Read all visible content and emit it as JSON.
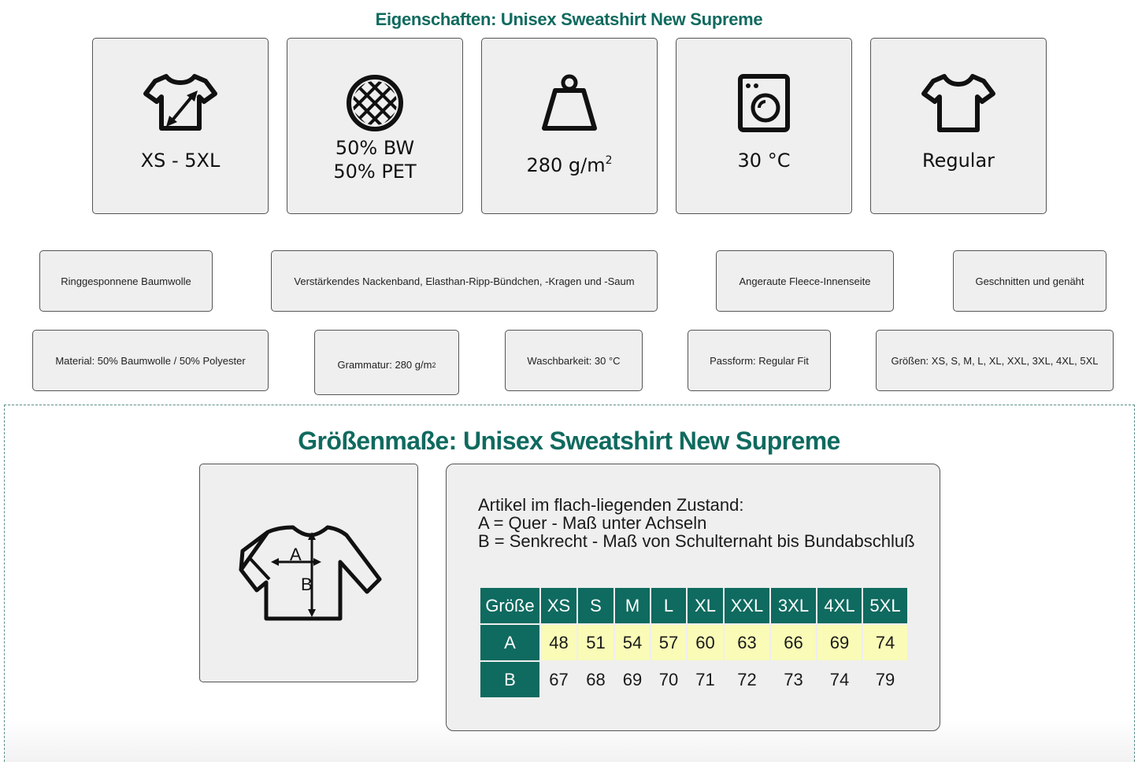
{
  "properties_title": "Eigenschaften: Unisex Sweatshirt New Supreme",
  "property_cards": [
    {
      "icon": "size-shirt-icon",
      "line1": "XS - 5XL"
    },
    {
      "icon": "fabric-mesh-icon",
      "line1": "50% BW",
      "line2": "50% PET"
    },
    {
      "icon": "weight-icon",
      "line1": "280 g/m",
      "sup": "2"
    },
    {
      "icon": "washing-machine-icon",
      "line1": "30 °C"
    },
    {
      "icon": "tshirt-icon",
      "line1": "Regular"
    }
  ],
  "features_row1": [
    "Ringgesponnene Baumwolle",
    "Verstärkendes Nackenband, Elasthan-Ripp-Bündchen, -Kragen und -Saum",
    "Angeraute Fleece-Innenseite",
    "Geschnitten und genäht"
  ],
  "features_row2": {
    "material": "Material: 50% Baumwolle / 50% Polyester",
    "grammage": "Grammatur: 280 g/m",
    "grammage_sup": "2",
    "wash": "Waschbarkeit: 30 °C",
    "fit": "Passform: Regular Fit",
    "sizes": "Größen: XS, S, M, L, XL, XXL, 3XL, 4XL, 5XL"
  },
  "sizes_title": "Größenmaße: Unisex Sweatshirt New Supreme",
  "diagram_labels": {
    "a": "A",
    "b": "B"
  },
  "description": [
    "Artikel im flach-liegenden Zustand:",
    "A = Quer - Maß unter Achseln",
    "B = Senkrecht - Maß von Schulternaht bis Bundabschluß"
  ],
  "size_table": {
    "header_label": "Größe",
    "sizes": [
      "XS",
      "S",
      "M",
      "L",
      "XL",
      "XXL",
      "3XL",
      "4XL",
      "5XL"
    ],
    "rows": [
      {
        "label": "A",
        "values": [
          "48",
          "51",
          "54",
          "57",
          "60",
          "63",
          "66",
          "69",
          "74"
        ]
      },
      {
        "label": "B",
        "values": [
          "67",
          "68",
          "69",
          "70",
          "71",
          "72",
          "73",
          "74",
          "79"
        ]
      }
    ]
  },
  "colors": {
    "accent": "#0f6a5f",
    "highlight": "#f9fbb7",
    "card": "#efefef"
  }
}
